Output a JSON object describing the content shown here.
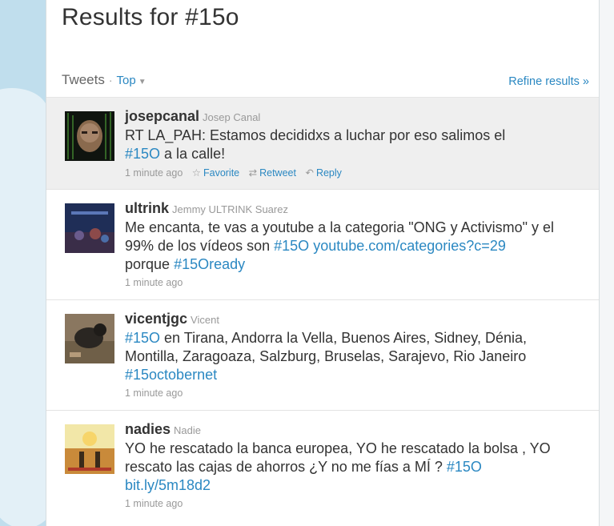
{
  "page": {
    "title": "Results for #15o"
  },
  "tabs": {
    "tweets": "Tweets",
    "separator": "·",
    "top": "Top",
    "refine": "Refine results »"
  },
  "colors": {
    "link": "#2b88c2",
    "background": "#c0deed",
    "highlight": "#efefef"
  },
  "tweets": [
    {
      "username": "josepcanal",
      "realname": "Josep Canal",
      "text1": "RT LA_PAH: Estamos decididxs a luchar por eso salimos el",
      "hashtag": "#15O",
      "text2": " a la calle!",
      "time": "1 minute ago",
      "actions": {
        "favorite": "Favorite",
        "retweet": "Retweet",
        "reply": "Reply"
      }
    },
    {
      "username": "ultrink",
      "realname": "Jemmy ULTRINK Suarez",
      "text1": "Me encanta, te vas a youtube a la categoria \"ONG y Activismo\" y el 99% de los vídeos son ",
      "hashtag": "#15O",
      "link": "youtube.com/categories?c=29",
      "text2": "porque ",
      "hashtag2": "#15Oready",
      "time": "1 minute ago"
    },
    {
      "username": "vicentjgc",
      "realname": "Vicent",
      "hashtag": "#15O",
      "text1": " en Tirana, Andorra la Vella, Buenos Aires, Sidney, Dénia, Montilla, Zaragoaza, Salzburg, Bruselas, Sarajevo, Rio Janeiro",
      "hashtag2": "#15octobernet",
      "time": "1 minute ago"
    },
    {
      "username": "nadies",
      "realname": "Nadie",
      "text1": "YO he rescatado la banca europea, YO he rescatado la bolsa , YO rescato las cajas de ahorros ¿Y no me fías a MÍ ? ",
      "hashtag": "#15O",
      "link": "bit.ly/5m18d2",
      "time": "1 minute ago"
    }
  ]
}
